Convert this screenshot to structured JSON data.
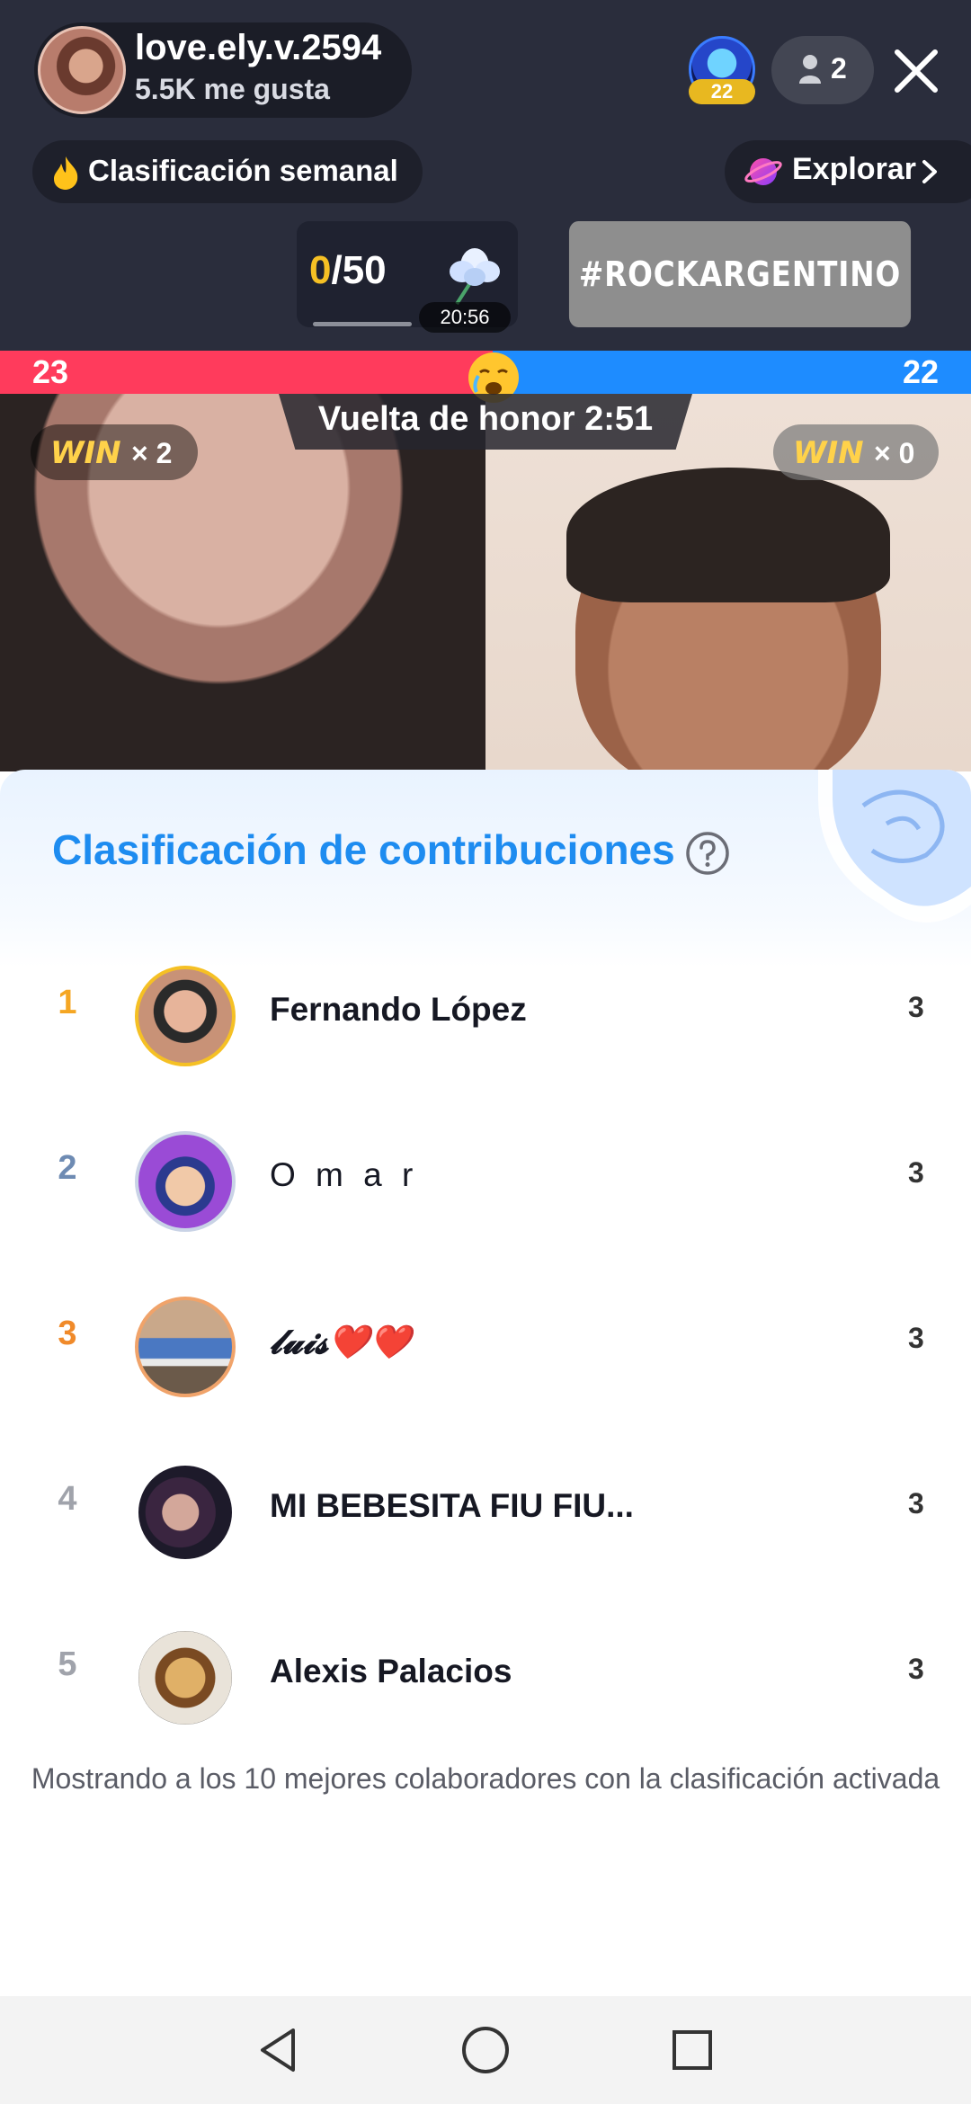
{
  "host": {
    "name": "love.ely.v.2594",
    "likes": "5.5K me gusta"
  },
  "badge": {
    "level": "22"
  },
  "viewers": {
    "count": "2"
  },
  "weekly": {
    "label": "Clasificación semanal"
  },
  "explore": {
    "label": "Explorar"
  },
  "goal": {
    "current": "0",
    "total": "/50",
    "timer": "20:56"
  },
  "hashtag": {
    "label": "#ROCKARGENTINO"
  },
  "battle": {
    "score_left": "23",
    "score_right": "22",
    "honor_label": "Vuelta de honor 2:51",
    "win_word": "WIN",
    "left_wins": "× 2",
    "right_wins": "× 0",
    "red_color": "#ff3b5c",
    "blue_color": "#1e8cff"
  },
  "sheet": {
    "title": "Clasificación de contribuciones",
    "rows": [
      {
        "rank": "1",
        "name": "Fernando López",
        "score": "3",
        "rank_color": "#f5a623"
      },
      {
        "rank": "2",
        "name": "O m a  r",
        "score": "3",
        "rank_color": "#6e8bb3"
      },
      {
        "rank": "3",
        "name": "𝓵𝓾𝓲𝓼❤️❤️",
        "score": "3",
        "rank_color": "#f08a2a"
      },
      {
        "rank": "4",
        "name": "MI BEBESITA FIU FIU...",
        "score": "3",
        "rank_color": "#a0a3ab"
      },
      {
        "rank": "5",
        "name": "Alexis Palacios",
        "score": "3",
        "rank_color": "#a0a3ab"
      }
    ],
    "footer": "Mostrando a los 10 mejores colaboradores con la clasificación activada"
  },
  "icons": {
    "close": "close-icon",
    "person": "person-icon",
    "flame": "flame-icon",
    "planet": "planet-icon",
    "help": "help-icon",
    "back": "back-triangle-icon",
    "home": "home-circle-icon",
    "recents": "recents-square-icon"
  }
}
